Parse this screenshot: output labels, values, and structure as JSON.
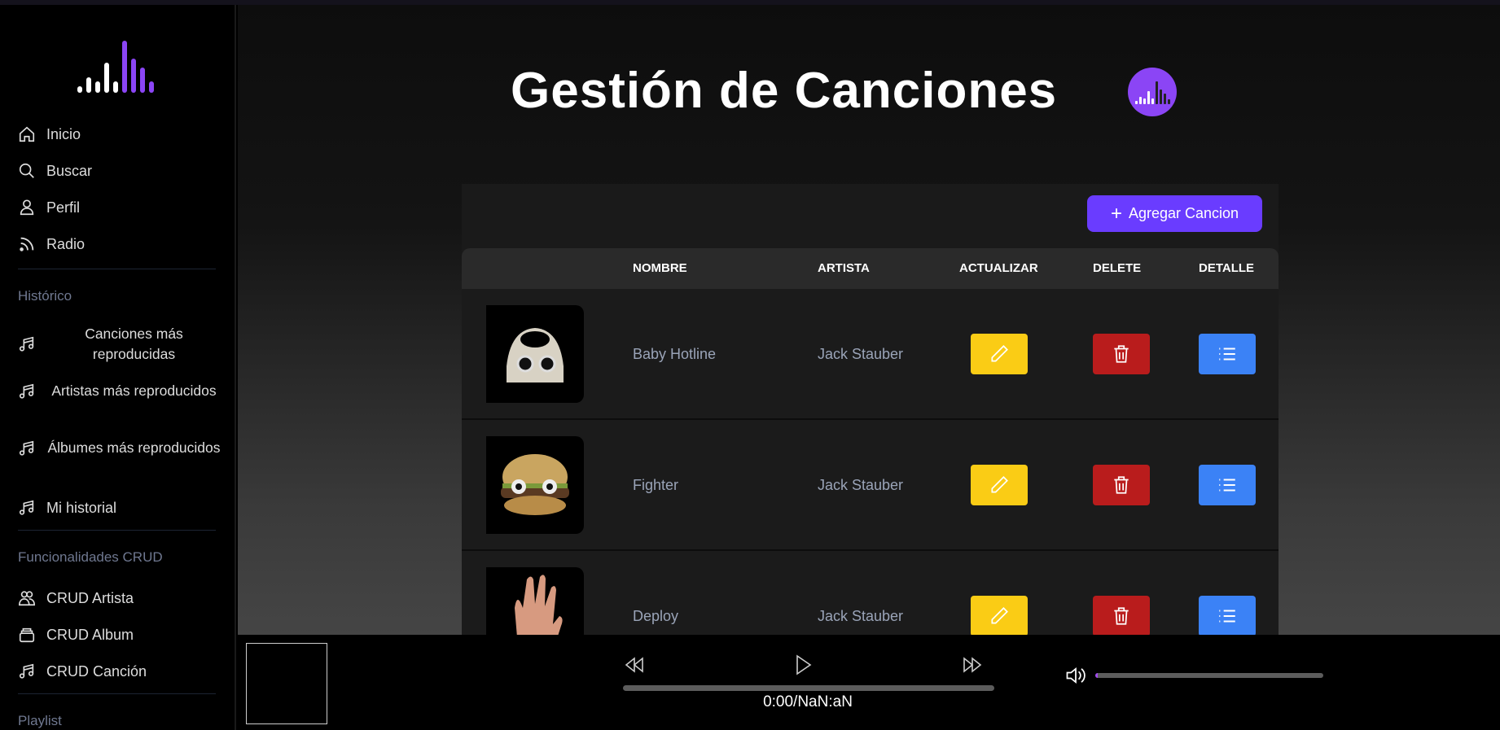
{
  "sidebar": {
    "nav": [
      {
        "label": "Inicio",
        "icon": "home-icon"
      },
      {
        "label": "Buscar",
        "icon": "search-icon"
      },
      {
        "label": "Perfil",
        "icon": "user-icon"
      },
      {
        "label": "Radio",
        "icon": "rss-icon"
      }
    ],
    "historico_title": "Histórico",
    "historico": [
      {
        "label": "Canciones más reproducidas",
        "icon": "music-icon"
      },
      {
        "label": "Artistas más reproducidos",
        "icon": "music-icon"
      },
      {
        "label": "Álbumes más reproducidos",
        "icon": "music-icon"
      },
      {
        "label": "Mi historial",
        "icon": "music-icon"
      }
    ],
    "crud_title": "Funcionalidades CRUD",
    "crud": [
      {
        "label": "CRUD Artista",
        "icon": "users-icon"
      },
      {
        "label": "CRUD Album",
        "icon": "album-icon"
      },
      {
        "label": "CRUD Canción",
        "icon": "music-icon"
      }
    ],
    "playlist_title": "Playlist"
  },
  "main": {
    "title": "Gestión de Canciones",
    "add_button": "Agregar Cancion",
    "columns": [
      "",
      "NOMBRE",
      "ARTISTA",
      "ACTUALIZAR",
      "DELETE",
      "DETALLE"
    ],
    "rows": [
      {
        "nombre": "Baby Hotline",
        "artista": "Jack Stauber"
      },
      {
        "nombre": "Fighter",
        "artista": "Jack Stauber"
      },
      {
        "nombre": "Deploy",
        "artista": "Jack Stauber"
      }
    ]
  },
  "player": {
    "time": "0:00/NaN:aN",
    "progress": 0,
    "volume": 0.01
  },
  "colors": {
    "accent": "#6a3cff",
    "update": "#facc15",
    "delete": "#b91c1c",
    "detail": "#3b82f6",
    "logo_purple": "#8b45f5"
  }
}
